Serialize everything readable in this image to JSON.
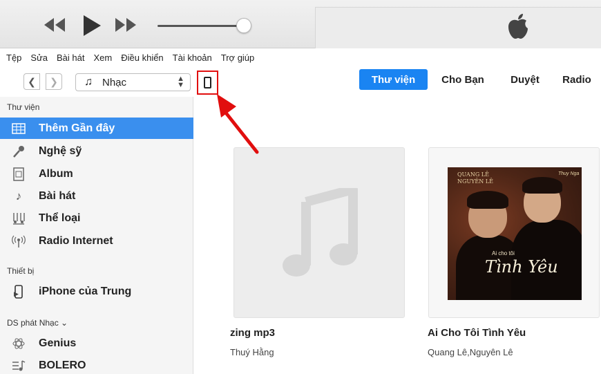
{
  "menu": [
    "Tệp",
    "Sửa",
    "Bài hát",
    "Xem",
    "Điều khiển",
    "Tài khoản",
    "Trợ giúp"
  ],
  "toolbar": {
    "library_selector": "Nhạc",
    "tabs": [
      "Thư viện",
      "Cho Bạn",
      "Duyệt",
      "Radio"
    ],
    "active_tab": "Thư viện"
  },
  "sidebar": {
    "library_header": "Thư viện",
    "library_items": [
      {
        "label": "Thêm Gần đây",
        "icon": "grid-icon",
        "selected": true
      },
      {
        "label": "Nghệ sỹ",
        "icon": "microphone-icon"
      },
      {
        "label": "Album",
        "icon": "album-icon"
      },
      {
        "label": "Bài hát",
        "icon": "music-note-icon"
      },
      {
        "label": "Thể loại",
        "icon": "genre-icon"
      },
      {
        "label": "Radio Internet",
        "icon": "radio-antenna-icon"
      }
    ],
    "devices_header": "Thiết bị",
    "device_name": "iPhone của Trung",
    "playlists_header": "DS phát Nhạc ⌄",
    "playlist_items": [
      {
        "label": "Genius",
        "icon": "genius-atom-icon"
      },
      {
        "label": "BOLERO",
        "icon": "playlist-icon"
      }
    ]
  },
  "albums": [
    {
      "title": "zing mp3",
      "artist": "Thuý Hằng",
      "artwork": "placeholder-note"
    },
    {
      "title": "Ai Cho Tôi Tình Yêu",
      "artist": "Quang Lê,Nguyên Lê",
      "artwork": "photo"
    }
  ],
  "cover_art": {
    "names": "QUANG LÊ NGUYÊN LÊ",
    "small": "Ai cho tôi",
    "script": "Tình Yêu",
    "logo": "Thuy Nga"
  },
  "colors": {
    "accent": "#1a84f2",
    "selection": "#3a8fee",
    "annotation_red": "#e10e0e"
  }
}
